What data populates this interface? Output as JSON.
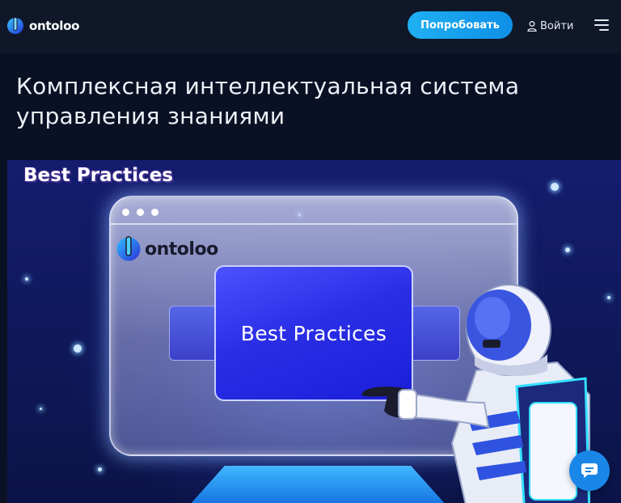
{
  "header": {
    "logo_text": "ontoloo",
    "try_button": "Попробовать",
    "login_label": "Войти"
  },
  "hero": {
    "title": "Комплексная интеллектуальная система управления знаниями"
  },
  "banner": {
    "title": "Best Practices",
    "window_logo_text": "ontoloo",
    "card_text": "Best Practices"
  },
  "colors": {
    "header_bg": "#0f1729",
    "accent": "#1fb0f2",
    "banner_bg": "#141c6e",
    "chat_button": "#1a86e8"
  },
  "icons": {
    "logo": "ontoloo-logo-icon",
    "login": "user-icon",
    "menu": "hamburger-menu-icon",
    "chat": "chat-icon"
  }
}
